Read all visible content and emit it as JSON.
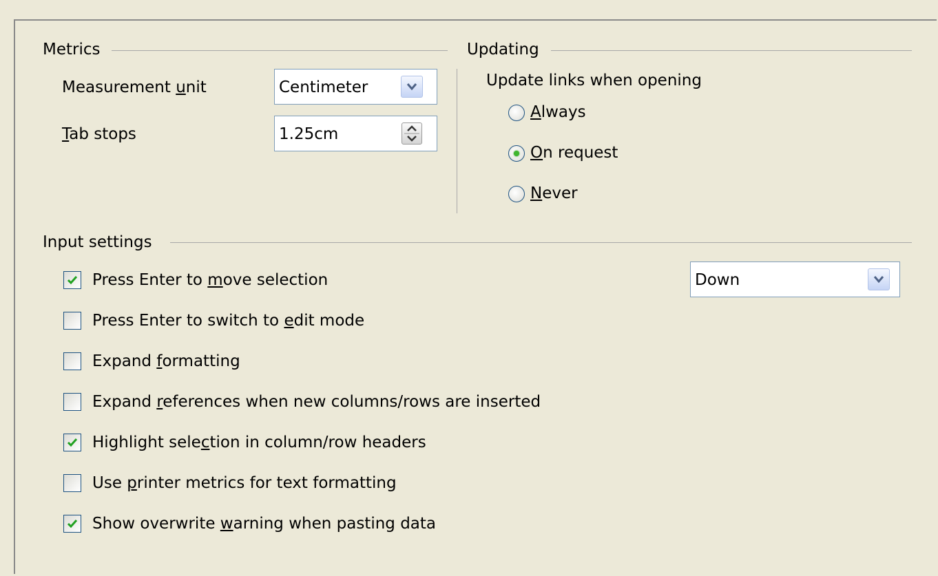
{
  "metrics": {
    "title": "Metrics",
    "measurement_unit_label": "Measurement unit",
    "measurement_unit_value": "Centimeter",
    "tab_stops_label": "Tab stops",
    "tab_stops_value": "1.25cm"
  },
  "updating": {
    "title": "Updating",
    "update_links_label": "Update links when opening",
    "options": [
      {
        "label": "Always",
        "selected": false
      },
      {
        "label": "On request",
        "selected": true
      },
      {
        "label": "Never",
        "selected": false
      }
    ]
  },
  "input_settings": {
    "title": "Input settings",
    "direction_value": "Down",
    "options": [
      {
        "label": "Press Enter to move selection",
        "checked": true
      },
      {
        "label": "Press Enter to switch to edit mode",
        "checked": false
      },
      {
        "label": "Expand formatting",
        "checked": false
      },
      {
        "label": "Expand references when new columns/rows are inserted",
        "checked": false
      },
      {
        "label": "Highlight selection in column/row headers",
        "checked": true
      },
      {
        "label": "Use printer metrics for text formatting",
        "checked": false
      },
      {
        "label": "Show overwrite warning when pasting data",
        "checked": true
      }
    ]
  },
  "colors": {
    "background": "#ece9d8",
    "check_green": "#21a121",
    "radio_green": "#3fb62e",
    "field_border": "#7f9db9"
  }
}
